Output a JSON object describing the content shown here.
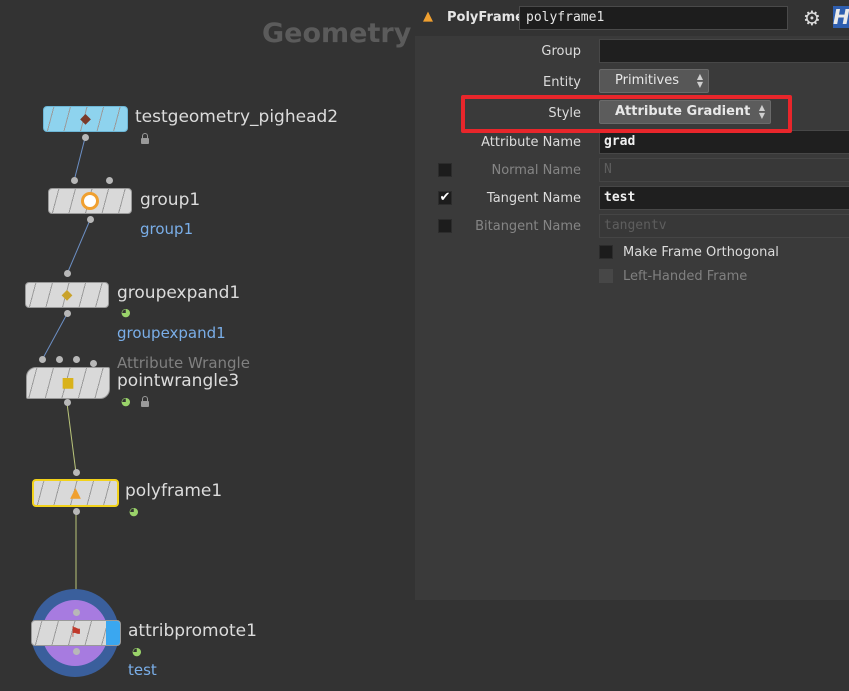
{
  "network": {
    "context_title": "Geometry",
    "nodes": [
      {
        "name": "testgeometry_pighead2",
        "icon": "pighead-icon"
      },
      {
        "name": "group1",
        "sublabel": "group1",
        "icon": "ring-icon"
      },
      {
        "name": "groupexpand1",
        "sublabel": "groupexpand1",
        "icon": "diamond-icon"
      },
      {
        "type_label": "Attribute Wrangle",
        "name": "pointwrangle3",
        "icon": "wrangle-icon"
      },
      {
        "name": "polyframe1",
        "icon": "polyframe-icon"
      },
      {
        "name": "attribpromote1",
        "sublabel": "test",
        "icon": "attribpromote-icon"
      }
    ]
  },
  "params": {
    "op_type": "PolyFrame",
    "op_name": "polyframe1",
    "help_glyph": "H",
    "group_label": "Group",
    "group_value": "",
    "entity_label": "Entity",
    "entity_value": "Primitives",
    "style_label": "Style",
    "style_value": "Attribute Gradient",
    "attribute_name_label": "Attribute Name",
    "attribute_name_value": "grad",
    "normal_name_label": "Normal Name",
    "normal_name_value": "N",
    "tangent_name_label": "Tangent Name",
    "tangent_name_value": "test",
    "bitangent_name_label": "Bitangent Name",
    "bitangent_name_value": "tangentv",
    "make_frame_orthogonal_label": "Make Frame Orthogonal",
    "left_handed_frame_label": "Left-Handed Frame",
    "normal_enabled": false,
    "tangent_enabled": true,
    "bitangent_enabled": false,
    "make_frame_orthogonal": false,
    "left_handed_frame": false
  },
  "colors": {
    "highlight_box": "#e8262b",
    "selected_node": "#f2d21b",
    "link_text": "#7aaee8",
    "display_flag": "#9ad36a"
  }
}
